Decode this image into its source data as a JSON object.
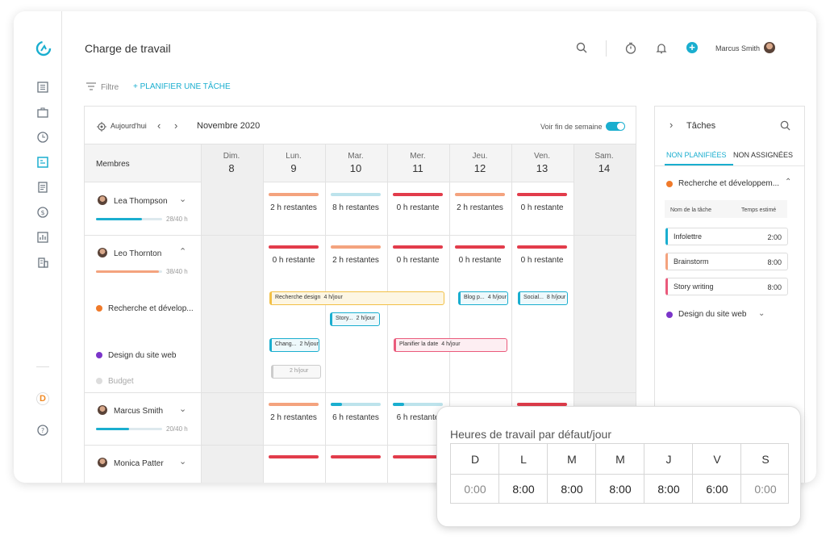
{
  "header": {
    "title": "Charge de travail",
    "user": "Marcus Smith"
  },
  "toolbar": {
    "filter": "Filtre",
    "plan": "+ PLANIFIER UNE TÂCHE"
  },
  "calendar": {
    "today": "Aujourd'hui",
    "month": "Novembre 2020",
    "weekend_toggle": "Voir fin de semaine",
    "members_header": "Membres",
    "days": [
      {
        "name": "Dim.",
        "num": "8"
      },
      {
        "name": "Lun.",
        "num": "9"
      },
      {
        "name": "Mar.",
        "num": "10"
      },
      {
        "name": "Mer.",
        "num": "11"
      },
      {
        "name": "Jeu.",
        "num": "12"
      },
      {
        "name": "Ven.",
        "num": "13"
      },
      {
        "name": "Sam.",
        "num": "14"
      }
    ],
    "members": [
      {
        "name": "Lea Thompson",
        "hours": "28/40 h",
        "progress": 0.7,
        "remaining": [
          "2 h restantes",
          "8 h restantes",
          "0 h restante",
          "2 h restantes",
          "0 h restante"
        ]
      },
      {
        "name": "Leo Thornton",
        "hours": "38/40 h",
        "progress": 0.95,
        "remaining": [
          "0 h restante",
          "2 h restantes",
          "0 h restante",
          "0 h restante",
          "0 h restante"
        ],
        "projects": [
          "Recherche et dévelop...",
          "Design du site web",
          "Budget"
        ],
        "tasks": [
          {
            "name": "Recherche design",
            "hours": "4 h/jour"
          },
          {
            "name": "Blog p...",
            "hours": "4 h/jour"
          },
          {
            "name": "Social...",
            "hours": "8 h/jour"
          },
          {
            "name": "Story...",
            "hours": "2 h/jour"
          },
          {
            "name": "Chang...",
            "hours": "2 h/jour"
          },
          {
            "name": "Planifier la date",
            "hours": "4 h/jour"
          },
          {
            "name": "",
            "hours": "2 h/jour"
          }
        ]
      },
      {
        "name": "Marcus Smith",
        "hours": "20/40 h",
        "progress": 0.5,
        "remaining": [
          "2 h restantes",
          "6 h restantes",
          "6 h restante"
        ]
      },
      {
        "name": "Monica Patter"
      }
    ]
  },
  "panel": {
    "title": "Tâches",
    "tab1": "NON PLANIFIÉES",
    "tab2": "NON ASSIGNÉES",
    "group1": "Recherche et développem...",
    "col1": "Nom de la tâche",
    "col2": "Temps estimé",
    "tasks": [
      {
        "name": "Infolettre",
        "time": "2:00"
      },
      {
        "name": "Brainstorm",
        "time": "8:00"
      },
      {
        "name": "Story writing",
        "time": "8:00"
      }
    ],
    "group2": "Design du site web"
  },
  "popup": {
    "title": "Heures de travail par défaut/jour",
    "days": [
      "D",
      "L",
      "M",
      "M",
      "J",
      "V",
      "S"
    ],
    "hours": [
      "0:00",
      "8:00",
      "8:00",
      "8:00",
      "8:00",
      "6:00",
      "0:00"
    ]
  },
  "colors": {
    "accent": "#1aaecf",
    "orange": "#f4a37e",
    "red": "#e23c4b",
    "lightblue": "#bde3ec",
    "yellow": "#f2c046",
    "pink": "#ea5a7b",
    "purple": "#7b35c9"
  }
}
